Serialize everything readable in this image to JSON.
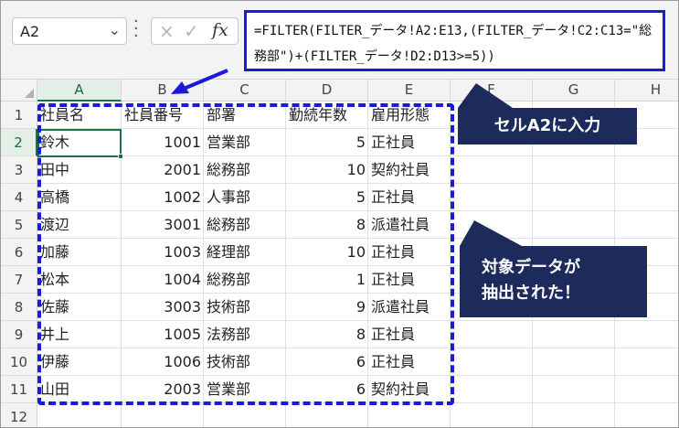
{
  "namebox": {
    "value": "A2",
    "arrow": "⌄"
  },
  "formula_bar": {
    "cancel_icon": "×",
    "enter_icon": "✓",
    "fx_label": "fx",
    "formula": "=FILTER(FILTER_データ!A2:E13,(FILTER_データ!C2:C13=\"総務部\")+(FILTER_データ!D2:D13>=5))"
  },
  "columns": [
    "A",
    "B",
    "C",
    "D",
    "E",
    "F",
    "G",
    "H"
  ],
  "rows": [
    "1",
    "2",
    "3",
    "4",
    "5",
    "6",
    "7",
    "8",
    "9",
    "10",
    "11",
    "12"
  ],
  "table": {
    "headers": [
      "社員名",
      "社員番号",
      "部署",
      "勤続年数",
      "雇用形態"
    ],
    "rows": [
      [
        "鈴木",
        "1001",
        "営業部",
        "5",
        "正社員"
      ],
      [
        "田中",
        "2001",
        "総務部",
        "10",
        "契約社員"
      ],
      [
        "高橋",
        "1002",
        "人事部",
        "5",
        "正社員"
      ],
      [
        "渡辺",
        "3001",
        "総務部",
        "8",
        "派遣社員"
      ],
      [
        "加藤",
        "1003",
        "経理部",
        "10",
        "正社員"
      ],
      [
        "松本",
        "1004",
        "総務部",
        "1",
        "正社員"
      ],
      [
        "佐藤",
        "3003",
        "技術部",
        "9",
        "派遣社員"
      ],
      [
        "井上",
        "1005",
        "法務部",
        "8",
        "正社員"
      ],
      [
        "伊藤",
        "1006",
        "技術部",
        "6",
        "正社員"
      ],
      [
        "山田",
        "2003",
        "営業部",
        "6",
        "契約社員"
      ]
    ]
  },
  "callouts": {
    "input_cell": "セルA2に入力",
    "extracted_line1": "対象データが",
    "extracted_line2": "抽出された！"
  },
  "colors": {
    "annotation_blue": "#1a1adb",
    "callout_navy": "#1d2b5c",
    "excel_green": "#1e7145"
  },
  "icons": {
    "cancel": "close-icon",
    "enter": "check-icon",
    "function": "fx-icon",
    "namebox_dropdown": "chevron-down-icon",
    "more": "vertical-dots-icon"
  }
}
